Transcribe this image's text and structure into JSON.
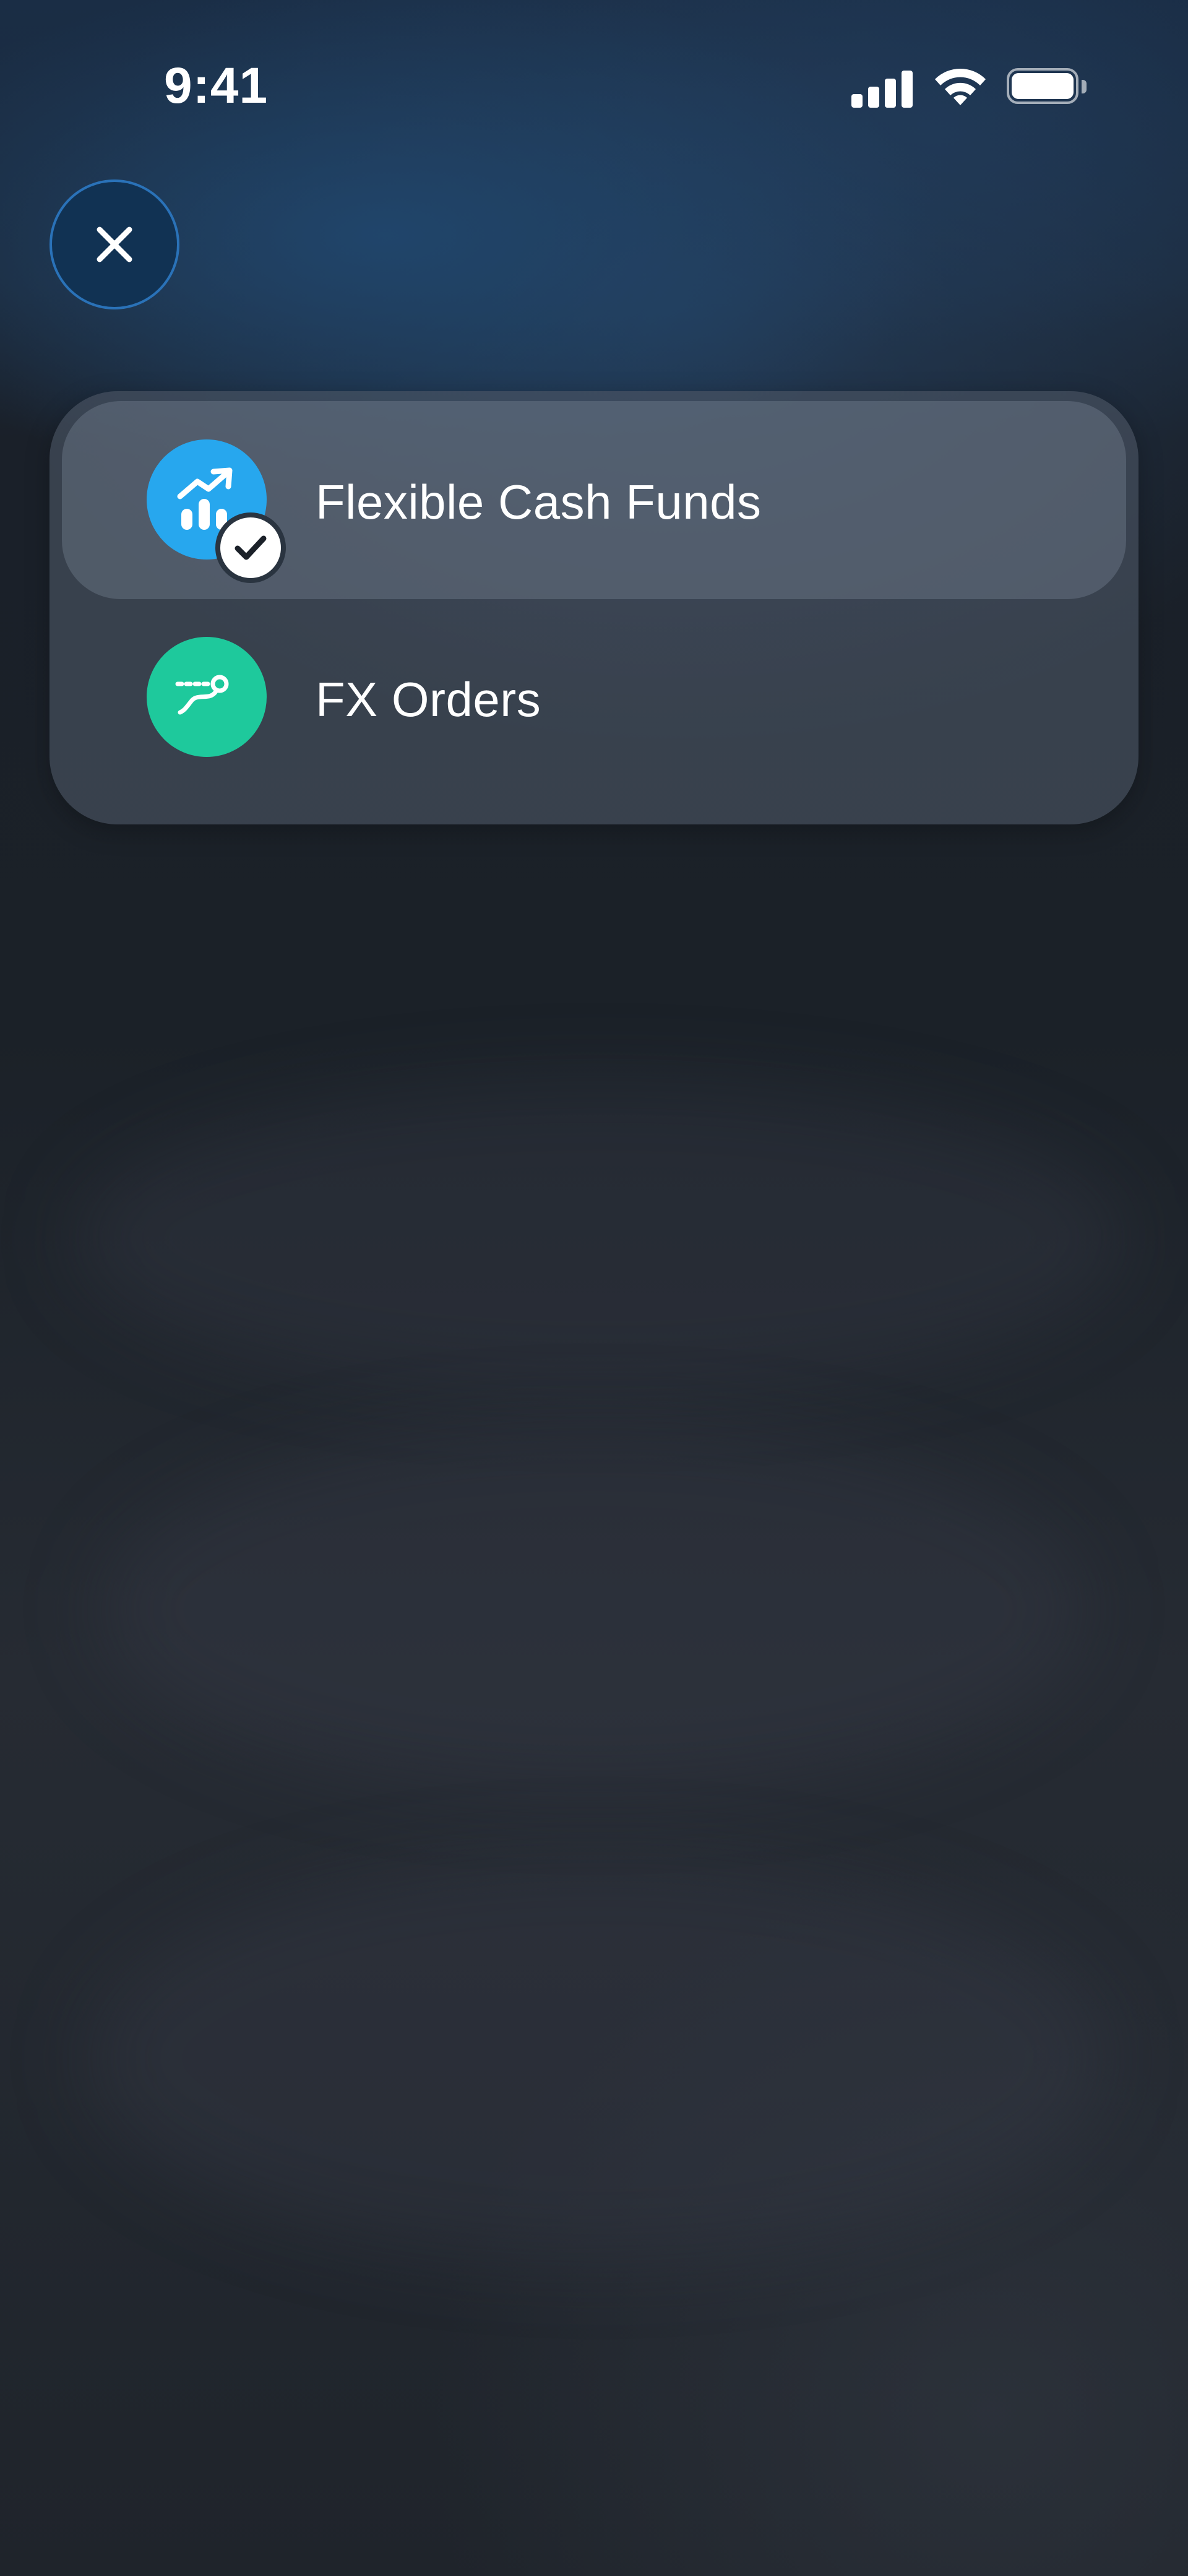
{
  "status_bar": {
    "time": "9:41",
    "icons": [
      "cellular-signal-icon",
      "wifi-icon",
      "battery-icon"
    ]
  },
  "close_button": {
    "icon": "close-icon"
  },
  "menu": {
    "items": [
      {
        "label": "Flexible Cash Funds",
        "icon": "growth-chart-icon",
        "icon_color": "#27a7ee",
        "selected": true,
        "badge_icon": "checkmark-icon"
      },
      {
        "label": "FX Orders",
        "icon": "route-icon",
        "icon_color": "#1ec99c",
        "selected": false
      }
    ]
  },
  "colors": {
    "background": "#1b2129",
    "close_button_fill": "#113253",
    "close_button_border": "#2a72b8"
  }
}
